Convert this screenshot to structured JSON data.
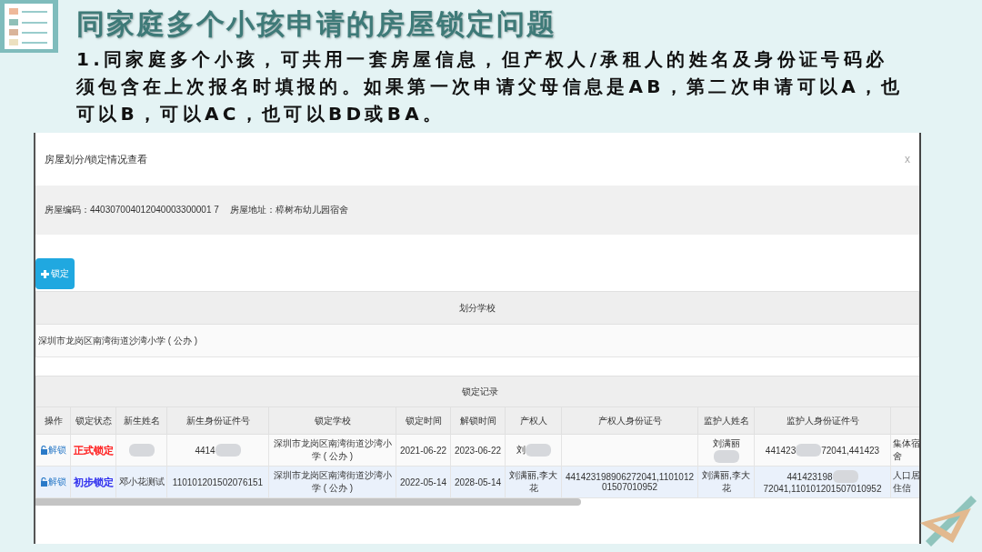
{
  "slide": {
    "title": "同家庭多个小孩申请的房屋锁定问题",
    "body": "1.同家庭多个小孩，可共用一套房屋信息，但产权人/承租人的姓名及身份证号码必须包含在上次报名时填报的。如果第一次申请父母信息是AB，第二次申请可以A，也可以B，可以AC，也可以BD或BA。"
  },
  "dialog": {
    "title": "房屋划分/锁定情况查看",
    "close": "x",
    "house_code_label": "房屋编码：",
    "house_code": "440307004012040003300001 7",
    "address_label": "房屋地址：",
    "address": "樟树布幼儿园宿舍",
    "lock_button": "锁定",
    "division": {
      "header": "划分学校",
      "rows": [
        "深圳市龙岗区南湾街道沙湾小学 ( 公办 )"
      ]
    },
    "records": {
      "title": "锁定记录",
      "columns": [
        "操作",
        "锁定状态",
        "新生姓名",
        "新生身份证件号",
        "锁定学校",
        "锁定时间",
        "解锁时间",
        "产权人",
        "产权人身份证号",
        "监护人姓名",
        "监护人身份证件号",
        ""
      ],
      "rows": [
        {
          "highlighted": false,
          "cells": [
            {
              "kind": "link",
              "text": "解锁"
            },
            {
              "kind": "status",
              "text": "正式锁定",
              "color": "#ff2020"
            },
            {
              "kind": "text",
              "redacted": true
            },
            {
              "kind": "text",
              "text": "4414",
              "redacted": true
            },
            {
              "kind": "text",
              "text": "深圳市龙岗区南湾街道沙湾小学 ( 公办 )"
            },
            {
              "kind": "text",
              "text": "2021-06-22"
            },
            {
              "kind": "text",
              "text": "2023-06-22"
            },
            {
              "kind": "text",
              "text": "刘",
              "redacted": true
            },
            {
              "kind": "text"
            },
            {
              "kind": "text",
              "text": "刘满丽",
              "redacted": true
            },
            {
              "kind": "text",
              "text": "441423",
              "redacted": true,
              "tail": "72041,441423"
            },
            {
              "kind": "text",
              "text": "集体宿舍"
            }
          ]
        },
        {
          "highlighted": true,
          "cells": [
            {
              "kind": "link",
              "text": "解锁"
            },
            {
              "kind": "status",
              "text": "初步锁定",
              "color": "#3030ee"
            },
            {
              "kind": "text",
              "text": "邓小花测试"
            },
            {
              "kind": "text",
              "text": "110101201502076151"
            },
            {
              "kind": "text",
              "text": "深圳市龙岗区南湾街道沙湾小学 ( 公办 )"
            },
            {
              "kind": "text",
              "text": "2022-05-14"
            },
            {
              "kind": "text",
              "text": "2028-05-14"
            },
            {
              "kind": "text",
              "text": "刘满丽,李大花"
            },
            {
              "kind": "text",
              "text": "441423198906272041,110101201507010952"
            },
            {
              "kind": "text",
              "text": "刘满丽,李大花"
            },
            {
              "kind": "text",
              "text": "441423198",
              "redacted": true,
              "tail": "72041,110101201507010952"
            },
            {
              "kind": "text",
              "text": "人口居住信"
            }
          ]
        }
      ]
    }
  }
}
